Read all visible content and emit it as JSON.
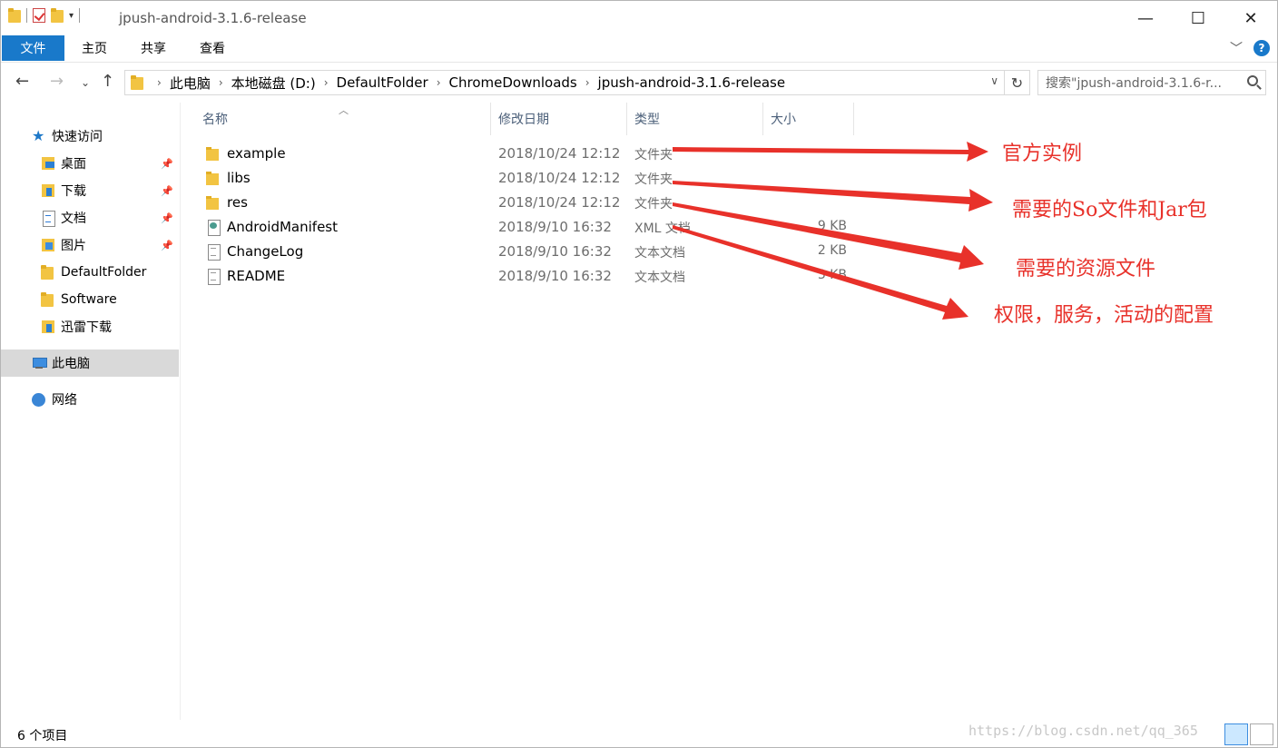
{
  "window": {
    "title": "jpush-android-3.1.6-release",
    "controls": {
      "minimize": "—",
      "maximize": "☐",
      "close": "✕"
    }
  },
  "ribbon": {
    "tabs": [
      "文件",
      "主页",
      "共享",
      "查看"
    ],
    "help_label": "?"
  },
  "address": {
    "crumbs": [
      "此电脑",
      "本地磁盘 (D:)",
      "DefaultFolder",
      "ChromeDownloads",
      "jpush-android-3.1.6-release"
    ],
    "search_placeholder": "搜索\"jpush-android-3.1.6-r..."
  },
  "nav": {
    "quick_access": "快速访问",
    "pinned": [
      "桌面",
      "下载",
      "文档",
      "图片"
    ],
    "folders": [
      "DefaultFolder",
      "Software",
      "迅雷下载"
    ],
    "this_pc": "此电脑",
    "network": "网络"
  },
  "columns": [
    "名称",
    "修改日期",
    "类型",
    "大小"
  ],
  "files": [
    {
      "name": "example",
      "date": "2018/10/24 12:12",
      "type": "文件夹",
      "size": "",
      "icon": "folder-icon"
    },
    {
      "name": "libs",
      "date": "2018/10/24 12:12",
      "type": "文件夹",
      "size": "",
      "icon": "folder-icon"
    },
    {
      "name": "res",
      "date": "2018/10/24 12:12",
      "type": "文件夹",
      "size": "",
      "icon": "folder-icon"
    },
    {
      "name": "AndroidManifest",
      "date": "2018/9/10 16:32",
      "type": "XML 文档",
      "size": "9 KB",
      "icon": "xml-file-icon"
    },
    {
      "name": "ChangeLog",
      "date": "2018/9/10 16:32",
      "type": "文本文档",
      "size": "2 KB",
      "icon": "text-file-icon"
    },
    {
      "name": "README",
      "date": "2018/9/10 16:32",
      "type": "文本文档",
      "size": "3 KB",
      "icon": "text-file-icon"
    }
  ],
  "annotations": [
    "官方实例",
    "需要的So文件和Jar包",
    "需要的资源文件",
    "权限，服务，活动的配置"
  ],
  "annotation_color": "#e8312a",
  "status": {
    "count": "6 个项目",
    "watermark": "https://blog.csdn.net/qq_365"
  }
}
